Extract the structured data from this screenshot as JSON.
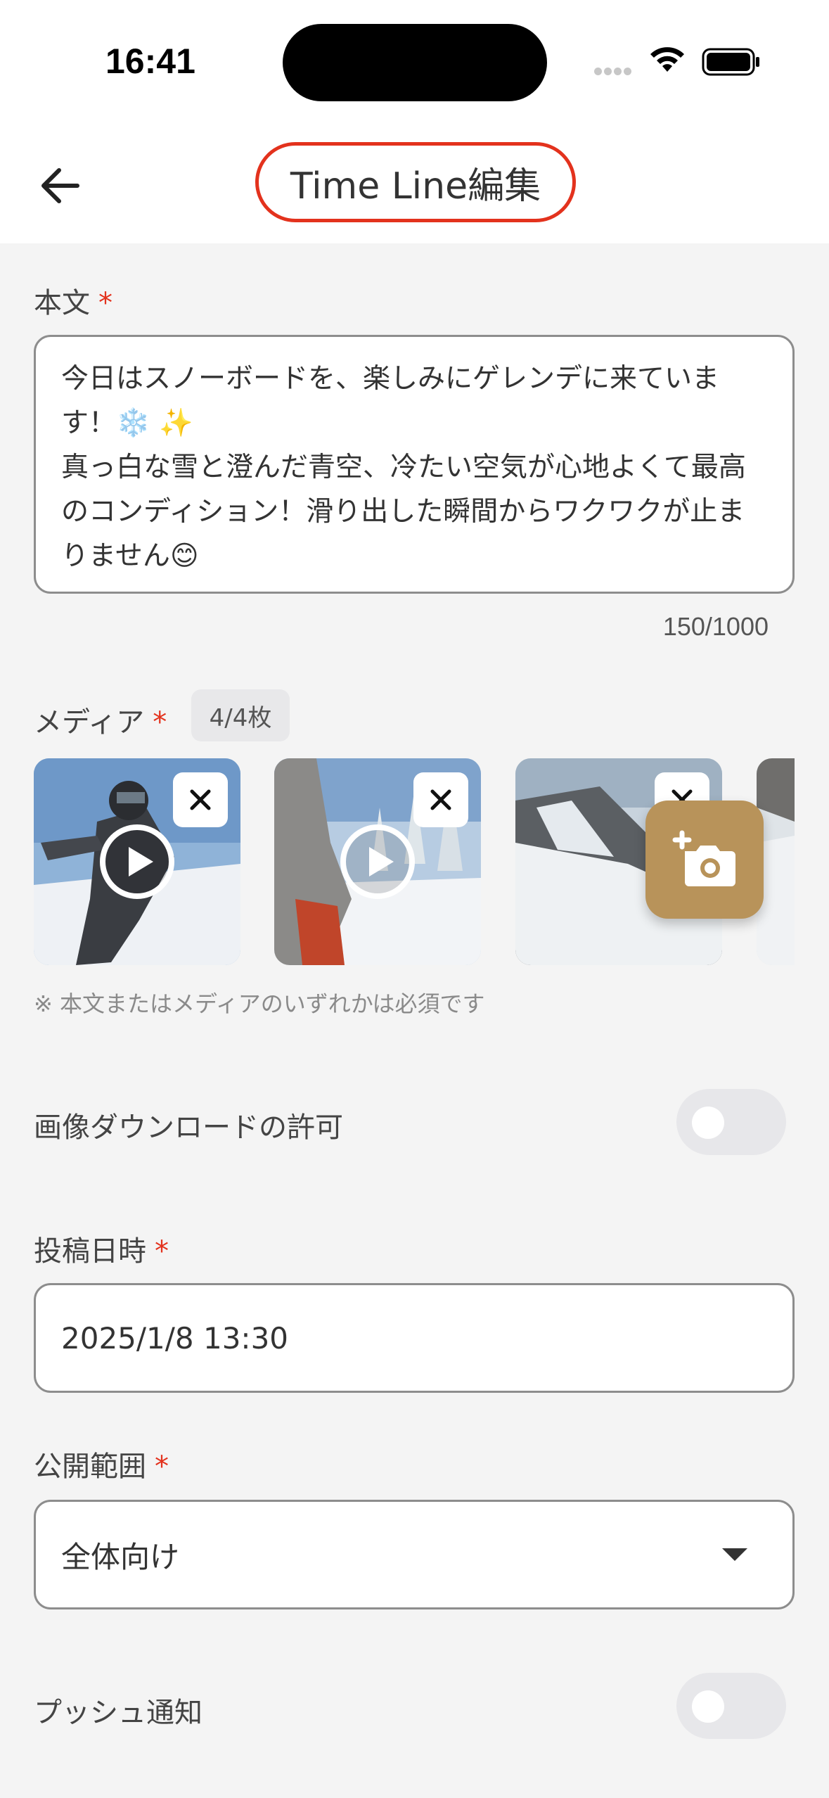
{
  "status_bar": {
    "time": "16:41"
  },
  "header": {
    "title": "Time Line編集"
  },
  "body_text": {
    "label": "本文",
    "required_mark": "*",
    "value": "今日はスノーボードを、楽しみにゲレンデに来ています！❄️ ✨\n真っ白な雪と澄んだ青空、冷たい空気が心地よくて最高のコンディション！滑り出した瞬間からワクワクが止まりません😊",
    "counter": "150/1000"
  },
  "media": {
    "label": "メディア",
    "required_mark": "*",
    "count_badge": "4/4枚",
    "note": "※ 本文またはメディアのいずれかは必須です",
    "items": [
      {
        "type": "video",
        "icon": "play-icon"
      },
      {
        "type": "video",
        "icon": "play-icon"
      },
      {
        "type": "image"
      },
      {
        "type": "image"
      }
    ],
    "add_icon": "add-photo-icon"
  },
  "download_permission": {
    "label": "画像ダウンロードの許可",
    "enabled": false
  },
  "post_datetime": {
    "label": "投稿日時",
    "required_mark": "*",
    "value": "2025/1/8 13:30"
  },
  "visibility": {
    "label": "公開範囲",
    "required_mark": "*",
    "value": "全体向け"
  },
  "push_notification": {
    "label": "プッシュ通知",
    "enabled": false
  },
  "colors": {
    "accent": "#b8935a",
    "required": "#e3321d",
    "title_outline": "#e3321d"
  }
}
